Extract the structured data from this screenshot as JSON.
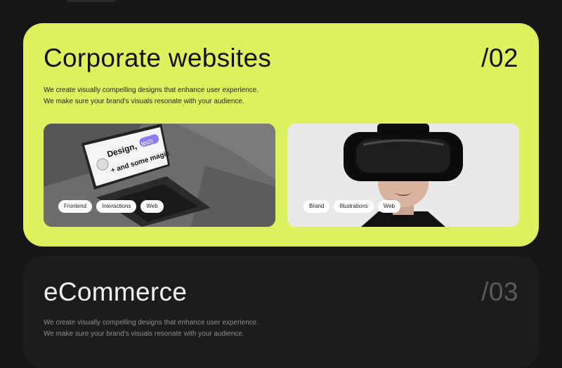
{
  "cards": [
    {
      "title": "Corporate websites",
      "number": "/02",
      "description": [
        "We create visually compelling designs that enhance user experience.",
        "We make sure your brand's visuals resonate with your audience."
      ],
      "projects": [
        {
          "image": "laptop-mockup",
          "screen_text": [
            "Design,",
            "tech",
            "+ and some magic"
          ],
          "tags": [
            "Frontend",
            "Interactions",
            "Web"
          ]
        },
        {
          "image": "vr-headset-portrait",
          "tags": [
            "Brand",
            "Illustrations",
            "Web"
          ]
        }
      ]
    },
    {
      "title": "eCommerce",
      "number": "/03",
      "description": [
        "We create visually compelling designs that enhance user experience.",
        "We make sure your brand's visuals resonate with your audience."
      ]
    }
  ],
  "colors": {
    "page_bg": "#161616",
    "accent": "#dff05e",
    "inactive_card": "#1c1c1c"
  }
}
